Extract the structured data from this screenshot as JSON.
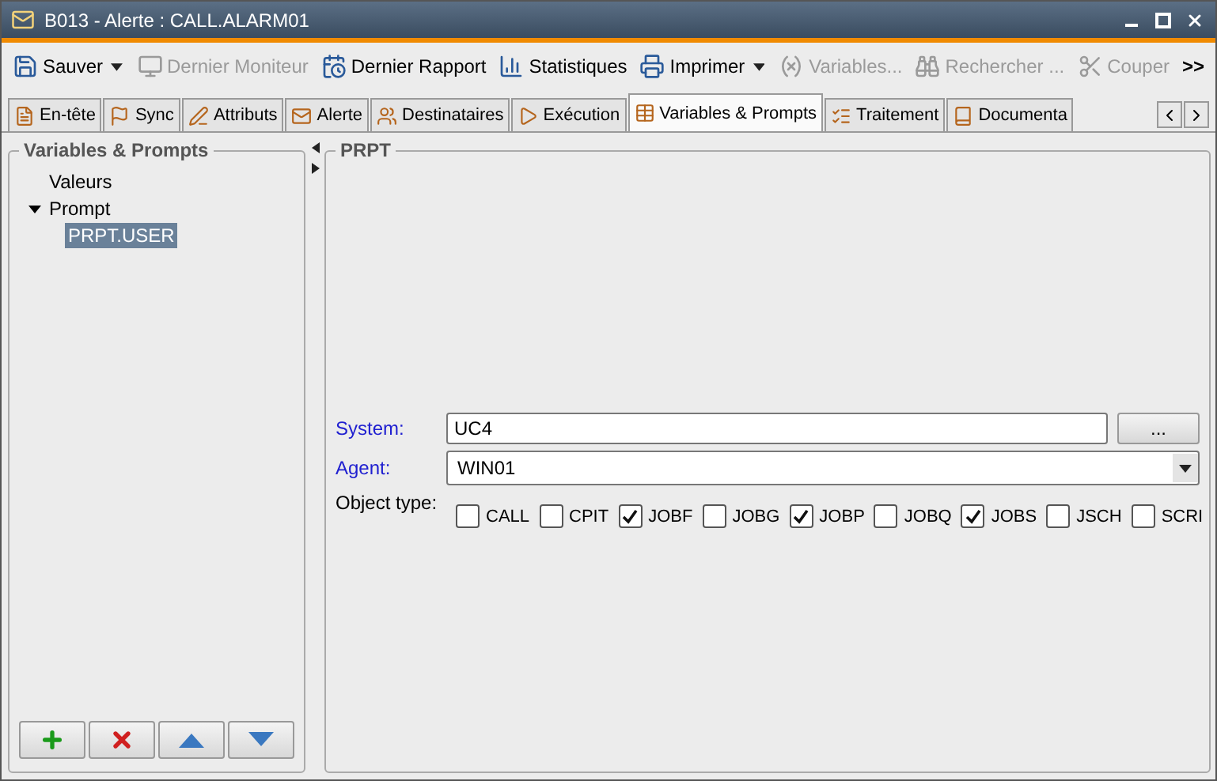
{
  "window": {
    "title": "B013 - Alerte : CALL.ALARM01"
  },
  "toolbar": [
    {
      "label": "Sauver",
      "kind": "dropdown",
      "disabled": false
    },
    {
      "label": "Dernier Moniteur",
      "kind": "button",
      "disabled": true
    },
    {
      "label": "Dernier Rapport",
      "kind": "button",
      "disabled": false
    },
    {
      "label": "Statistiques",
      "kind": "button",
      "disabled": false
    },
    {
      "label": "Imprimer",
      "kind": "dropdown",
      "disabled": false
    },
    {
      "label": "Variables...",
      "kind": "button",
      "disabled": true
    },
    {
      "label": "Rechercher ...",
      "kind": "button",
      "disabled": true
    },
    {
      "label": "Couper",
      "kind": "button",
      "disabled": true
    },
    {
      "label": ">>",
      "kind": "overflow"
    }
  ],
  "tabs": [
    {
      "label": "En-tête",
      "selected": false
    },
    {
      "label": "Sync",
      "selected": false
    },
    {
      "label": "Attributs",
      "selected": false
    },
    {
      "label": "Alerte",
      "selected": false
    },
    {
      "label": "Destinataires",
      "selected": false
    },
    {
      "label": "Exécution",
      "selected": false
    },
    {
      "label": "Variables & Prompts",
      "selected": true
    },
    {
      "label": "Traitement",
      "selected": false
    },
    {
      "label": "Documenta",
      "selected": false
    }
  ],
  "sidebar": {
    "title": "Variables & Prompts",
    "items": [
      {
        "label": "Valeurs",
        "selected": false
      },
      {
        "label": "Prompt",
        "selected": false,
        "expanded": true,
        "children": [
          {
            "label": "PRPT.USER",
            "selected": true
          }
        ]
      }
    ]
  },
  "panel": {
    "title": "PRPT",
    "fields": [
      {
        "label": "System:",
        "kind": "text",
        "required": true,
        "value": "UC4",
        "button": "..."
      },
      {
        "label": "Agent:",
        "kind": "combo",
        "required": true,
        "value": "WIN01"
      }
    ],
    "object_type": {
      "label": "Object type:",
      "options": [
        {
          "label": "CALL",
          "checked": false
        },
        {
          "label": "CPIT",
          "checked": false
        },
        {
          "label": "JOBF",
          "checked": true
        },
        {
          "label": "JOBG",
          "checked": false
        },
        {
          "label": "JOBP",
          "checked": true
        },
        {
          "label": "JOBQ",
          "checked": false
        },
        {
          "label": "JOBS",
          "checked": true
        },
        {
          "label": "JSCH",
          "checked": false
        },
        {
          "label": "SCRI",
          "checked": false
        }
      ]
    }
  }
}
